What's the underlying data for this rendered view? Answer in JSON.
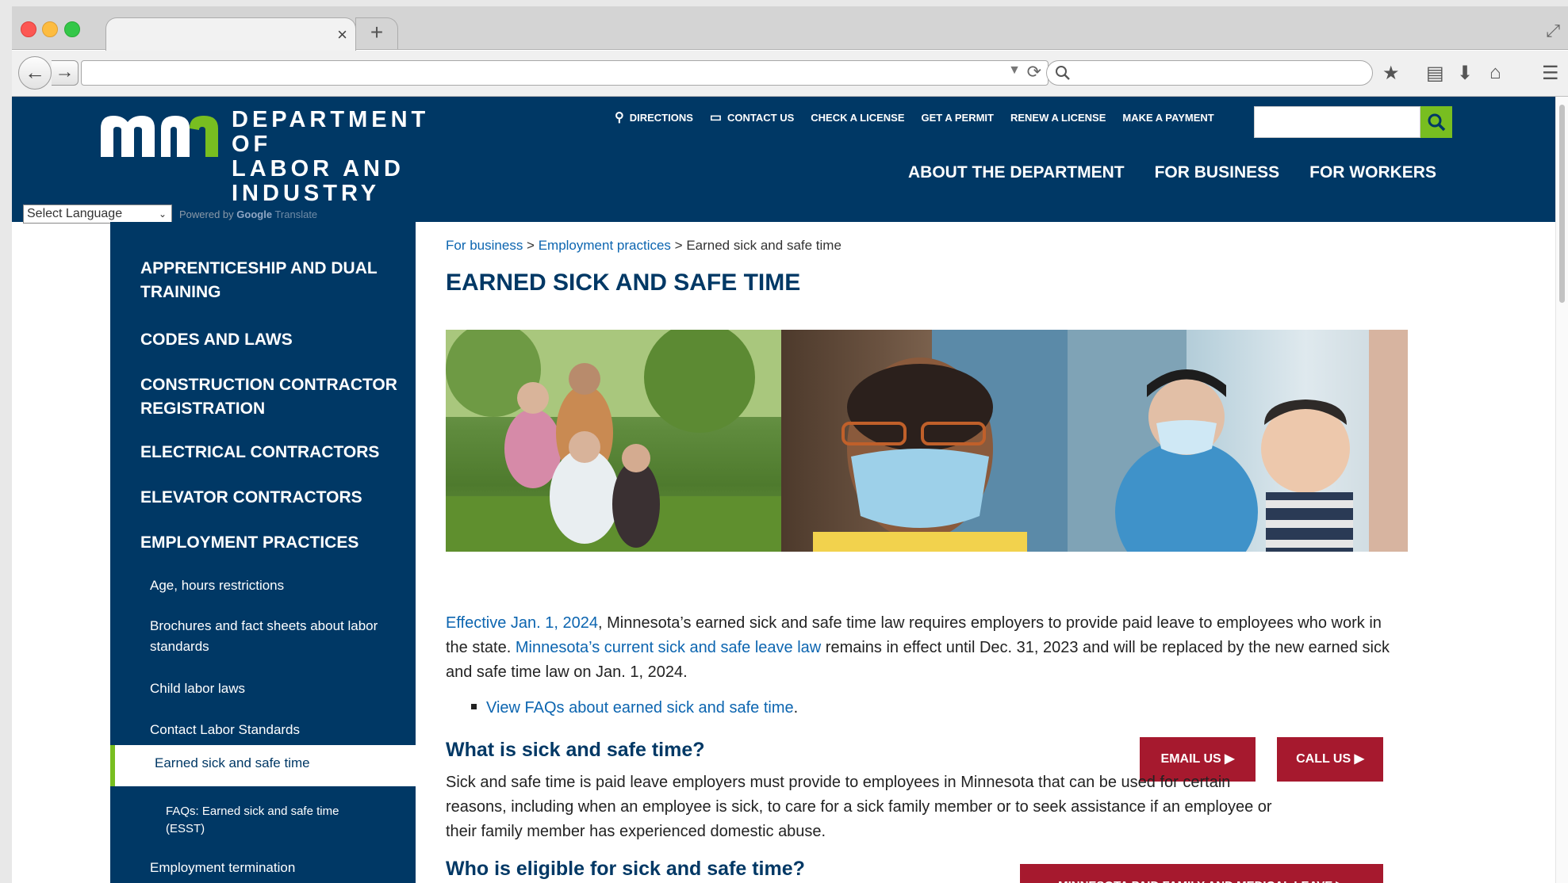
{
  "browser": {
    "tab_close": "×",
    "new_tab": "+",
    "url": "",
    "search_placeholder": ""
  },
  "header": {
    "logo_line1": "DEPARTMENT OF",
    "logo_line2": "LABOR AND INDUSTRY",
    "utility_links": [
      {
        "label": "DIRECTIONS",
        "icon": "map-pin-icon"
      },
      {
        "label": "CONTACT US",
        "icon": "chat-icon"
      },
      {
        "label": "CHECK A LICENSE"
      },
      {
        "label": "GET A PERMIT"
      },
      {
        "label": "RENEW A LICENSE"
      },
      {
        "label": "MAKE A PAYMENT"
      }
    ],
    "main_nav": [
      "ABOUT THE DEPARTMENT",
      "FOR BUSINESS",
      "FOR WORKERS"
    ],
    "language_select": "Select Language",
    "powered_by": "Powered by",
    "google": "Google",
    "translate": "Translate",
    "colors": {
      "navy": "#003865",
      "green": "#78be20",
      "red": "#a6192e",
      "link": "#0c65b0"
    }
  },
  "sidebar": {
    "top_items": [
      "APPRENTICESHIP AND DUAL TRAINING",
      "CODES AND LAWS",
      "CONSTRUCTION CONTRACTOR REGISTRATION",
      "ELECTRICAL CONTRACTORS",
      "ELEVATOR CONTRACTORS",
      "EMPLOYMENT PRACTICES"
    ],
    "sub_items": [
      "Age, hours restrictions",
      "Brochures and fact sheets about labor standards",
      "Child labor laws",
      "Contact Labor Standards"
    ],
    "active_item": "Earned sick and safe time",
    "subsub_item": "FAQs: Earned sick and safe time (ESST)",
    "after_item": "Employment termination"
  },
  "content": {
    "breadcrumb": {
      "crumb1": "For business",
      "sep": " > ",
      "crumb2": "Employment practices",
      "current": "Earned sick and safe time"
    },
    "title": "EARNED SICK AND SAFE TIME",
    "intro": {
      "link1": "Effective Jan. 1, 2024",
      "text1": ", Minnesota’s earned sick and safe time law requires employers to provide paid leave to employees who work in the state. ",
      "link2": "Minnesota’s current sick and safe leave law",
      "text2": " remains in effect until Dec. 31, 2023 and will be replaced by the new earned sick and safe time law on Jan. 1, 2024."
    },
    "faq_link": "View FAQs about earned sick and safe time",
    "faq_period": ".",
    "h2_what": "What is sick and safe time?",
    "what_text": "Sick and safe time is paid leave employers must provide to employees in Minnesota that can be used for certain reasons, including when an employee is sick, to care for a sick family member or to seek assistance if an employee or their family member has experienced domestic abuse.",
    "email_btn": "EMAIL US ▶",
    "call_btn": "CALL US ▶",
    "h2_who": "Who is eligible for sick and safe time?",
    "pfml_btn": "MINNESOTA PAID FAMILY AND MEDICAL LEAVE ▶"
  }
}
